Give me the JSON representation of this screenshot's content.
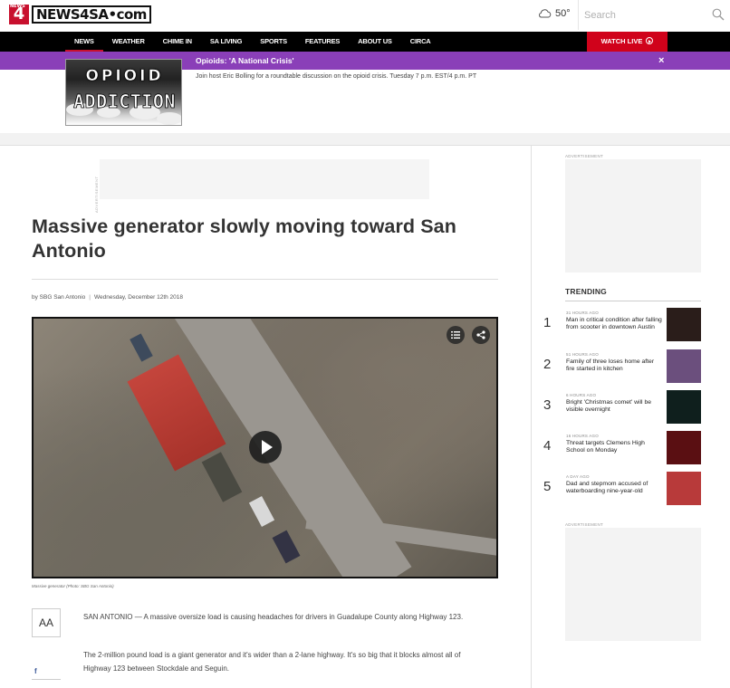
{
  "header": {
    "logo_number": "4",
    "logo_badge_small": "NEWS",
    "logo_text": "NEWS4SA",
    "logo_suffix": "•com",
    "weather_temp": "50°",
    "weather_icon": "cloud-icon",
    "search_placeholder": "Search"
  },
  "nav": {
    "items": [
      "NEWS",
      "WEATHER",
      "CHIME IN",
      "SA LIVING",
      "SPORTS",
      "FEATURES",
      "ABOUT US",
      "CIRCA"
    ],
    "active": "NEWS",
    "watch_live": "WATCH LIVE"
  },
  "promo": {
    "title": "Opioids: 'A National Crisis'",
    "description": "Join host Eric Bolling for a roundtable discussion on the opioid crisis. Tuesday 7 p.m. EST/4 p.m. PT",
    "image_line1": "OPIOID",
    "image_line2": "ADDICTION",
    "close": "×"
  },
  "article": {
    "ad_label": "ADVERTISEMENT",
    "headline": "Massive generator slowly moving toward San Antonio",
    "byline_author": "by SBG San Antonio",
    "byline_date": "Wednesday, December 12th 2018",
    "caption": "Massive generator (Photo: SBG San Antonio)",
    "font_button": "AA",
    "facebook": "f",
    "paragraphs": [
      "SAN ANTONIO — A massive oversize load is causing headaches for drivers in Guadalupe County along Highway 123.",
      "The 2-million pound load is a giant generator and it's wider than a 2-lane highway. It's so big that it blocks almost all of Highway 123 between Stockdale and Seguin."
    ]
  },
  "sidebar": {
    "ad_label": "ADVERTISEMENT",
    "trending_title": "TRENDING",
    "trending": [
      {
        "num": "1",
        "time": "31 HOURS AGO",
        "headline": "Man in critical condition after falling from scooter in downtown Austin",
        "thumb_color": "#2a1d1a"
      },
      {
        "num": "2",
        "time": "51 HOURS AGO",
        "headline": "Family of three loses home after fire started in kitchen",
        "thumb_color": "#6b4f7d"
      },
      {
        "num": "3",
        "time": "6 HOURS AGO",
        "headline": "Bright 'Christmas comet' will be visible overnight",
        "thumb_color": "#0f1f1d"
      },
      {
        "num": "4",
        "time": "16 HOURS AGO",
        "headline": "Threat targets Clemens High School on Monday",
        "thumb_color": "#5a0f12"
      },
      {
        "num": "5",
        "time": "A DAY AGO",
        "headline": "Dad and stepmom accused of waterboarding nine-year-old",
        "thumb_color": "#b83a3a"
      }
    ]
  }
}
